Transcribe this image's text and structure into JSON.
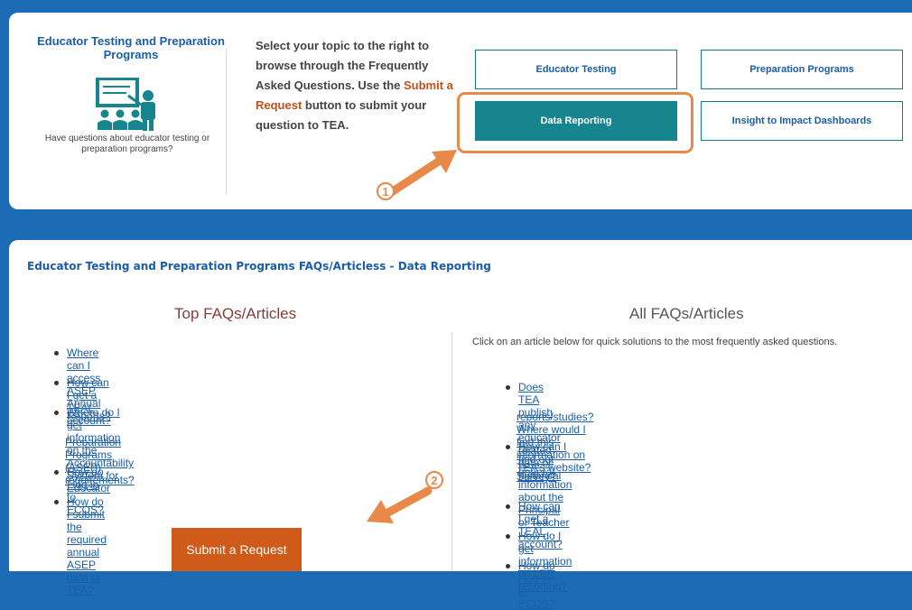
{
  "hero": {
    "title": "Educator Testing and Preparation Programs",
    "caption": "Have questions about educator testing or preparation programs?",
    "intro_before": "Select your topic to the right to browse through the Frequently Asked Questions. Use the ",
    "intro_highlight": "Submit a Request",
    "intro_after": " button to submit your question to TEA."
  },
  "topics": [
    "Educator Testing",
    "Preparation Programs",
    "Data Reporting",
    "Insight to Impact Dashboards"
  ],
  "active_topic": "Data Reporting",
  "annotations": [
    "1",
    "2"
  ],
  "section_title": "Educator Testing and Preparation Programs FAQs/Articless - Data Reporting",
  "top_faqs": {
    "heading": "Top FAQs/Articles",
    "items": [
      "Where can I access ASEP Annual Reports?",
      "How can I get a TEAL account?",
      "Where do I get information on the Accountability System for Educator",
      "Preparation Programs (ASEP) requirements?",
      "How do I log in to ECOS?",
      "How do I submit the required annual ASEP data to TEA?"
    ],
    "submit_label": "Submit a Request"
  },
  "all_faqs": {
    "heading": "All FAQs/Articles",
    "description": "Click on an article below for quick solutions to the most frequently asked questions.",
    "items": [
      "Does TEA publish any educator related data or historical",
      "reports/studies? Where would I find this information on TEA's website?",
      "How can I find out general information about the Principal or Teacher",
      "Survey?",
      "How can I get a TEAL account?",
      "How do I get information on LBB reporting?",
      "How do I log in to ECOS?"
    ]
  },
  "colors": {
    "accent": "#17858d",
    "brand": "#1c6cb5",
    "submit": "#cf5a1a",
    "annotation": "#e8894a"
  }
}
